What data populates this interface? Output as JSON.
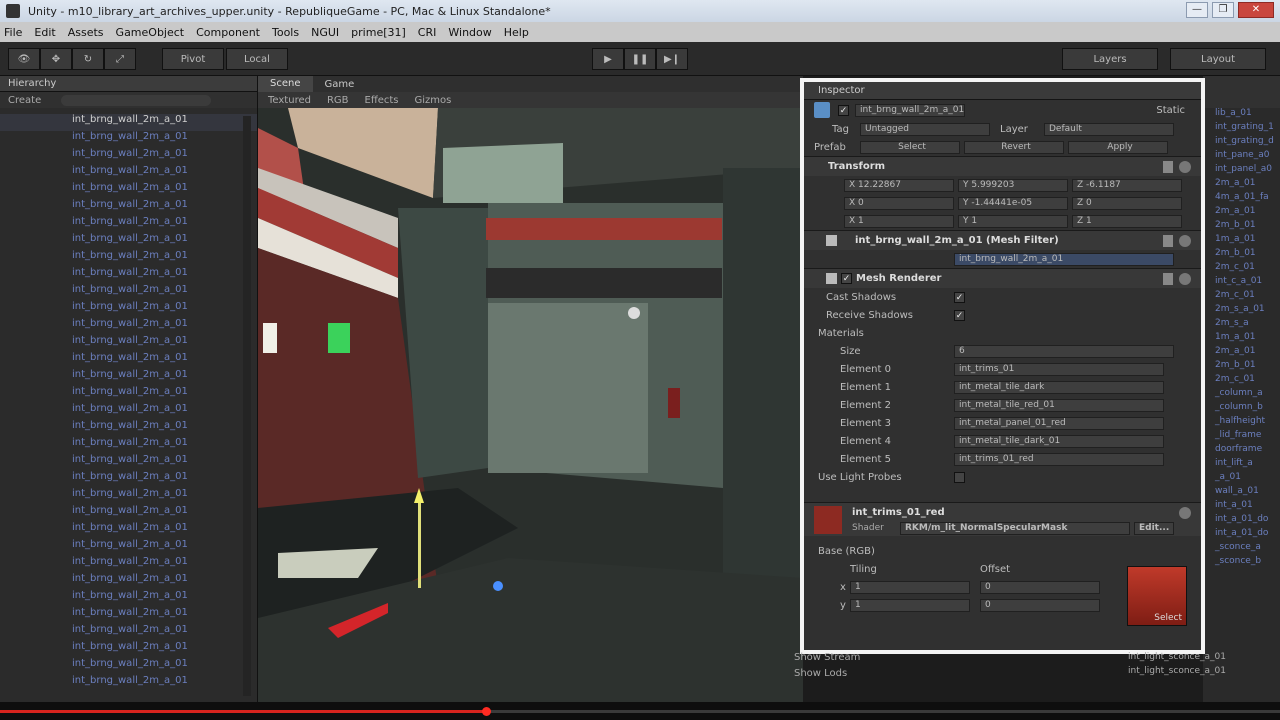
{
  "window": {
    "title": "Unity - m10_library_art_archives_upper.unity - RepubliqueGame - PC, Mac & Linux Standalone*",
    "minimize": "—",
    "maximize": "❐",
    "close": "✕"
  },
  "menu": [
    "File",
    "Edit",
    "Assets",
    "GameObject",
    "Component",
    "Tools",
    "NGUI",
    "prime[31]",
    "CRI",
    "Window",
    "Help"
  ],
  "toolbar": {
    "pivot": "Pivot",
    "local": "Local",
    "play": "▶",
    "pause": "❚❚",
    "step": "▶❙",
    "layers": "Layers",
    "layout": "Layout"
  },
  "hierarchy": {
    "tab": "Hierarchy",
    "create": "Create",
    "selected": "int_brng_wall_2m_a_01",
    "rows": [
      "int_brng_wall_2m_a_01",
      "int_brng_wall_2m_a_01",
      "int_brng_wall_2m_a_01",
      "int_brng_wall_2m_a_01",
      "int_brng_wall_2m_a_01",
      "int_brng_wall_2m_a_01",
      "int_brng_wall_2m_a_01",
      "int_brng_wall_2m_a_01",
      "int_brng_wall_2m_a_01",
      "int_brng_wall_2m_a_01",
      "int_brng_wall_2m_a_01",
      "int_brng_wall_2m_a_01",
      "int_brng_wall_2m_a_01",
      "int_brng_wall_2m_a_01",
      "int_brng_wall_2m_a_01",
      "int_brng_wall_2m_a_01",
      "int_brng_wall_2m_a_01",
      "int_brng_wall_2m_a_01",
      "int_brng_wall_2m_a_01",
      "int_brng_wall_2m_a_01",
      "int_brng_wall_2m_a_01",
      "int_brng_wall_2m_a_01",
      "int_brng_wall_2m_a_01",
      "int_brng_wall_2m_a_01",
      "int_brng_wall_2m_a_01",
      "int_brng_wall_2m_a_01",
      "int_brng_wall_2m_a_01",
      "int_brng_wall_2m_a_01",
      "int_brng_wall_2m_a_01",
      "int_brng_wall_2m_a_01",
      "int_brng_wall_2m_a_01",
      "int_brng_wall_2m_a_01",
      "int_brng_wall_2m_a_01"
    ]
  },
  "scene": {
    "tab_scene": "Scene",
    "tab_game": "Game",
    "textured": "Textured",
    "rgb": "RGB",
    "effects": "Effects",
    "gizmos": "Gizmos"
  },
  "inspector": {
    "tab": "Inspector",
    "object_name": "int_brng_wall_2m_a_01",
    "static": "Static",
    "tag_label": "Tag",
    "tag_value": "Untagged",
    "layer_label": "Layer",
    "layer_value": "Default",
    "prefab_label": "Prefab",
    "select": "Select",
    "revert": "Revert",
    "apply": "Apply",
    "transform": "Transform",
    "pos_x": "X 12.22867",
    "pos_y": "Y 5.999203",
    "pos_z": "Z -6.1187",
    "rot_x": "X 0",
    "rot_y": "Y -1.44441e-05",
    "rot_z": "Z 0",
    "scl_x": "X 1",
    "scl_y": "Y 1",
    "scl_z": "Z 1",
    "mesh_filter": "int_brng_wall_2m_a_01 (Mesh Filter)",
    "mesh_value": "int_brng_wall_2m_a_01",
    "mesh_renderer": "Mesh Renderer",
    "cast_shadows": "Cast Shadows",
    "receive_shadows": "Receive Shadows",
    "materials": "Materials",
    "size_label": "Size",
    "size_value": "6",
    "elements": [
      {
        "label": "Element 0",
        "value": "int_trims_01"
      },
      {
        "label": "Element 1",
        "value": "int_metal_tile_dark"
      },
      {
        "label": "Element 2",
        "value": "int_metal_tile_red_01"
      },
      {
        "label": "Element 3",
        "value": "int_metal_panel_01_red"
      },
      {
        "label": "Element 4",
        "value": "int_metal_tile_dark_01"
      },
      {
        "label": "Element 5",
        "value": "int_trims_01_red"
      }
    ],
    "light_probes": "Use Light Probes",
    "material_name": "int_trims_01_red",
    "shader_label": "Shader",
    "shader_value": "RKM/m_lit_NormalSpecularMask",
    "edit": "Edit...",
    "base_rgb": "Base (RGB)",
    "tiling": "Tiling",
    "offset": "Offset",
    "x": "x",
    "y": "y",
    "tile_x": "1",
    "tile_y": "1",
    "off_x": "0",
    "off_y": "0",
    "select_btn": "Select"
  },
  "right_panel": [
    "lib_a_01",
    "int_grating_1",
    "int_grating_d",
    "int_pane_a0",
    "int_panel_a0",
    "2m_a_01",
    "4m_a_01_fa",
    "2m_a_01",
    "2m_b_01",
    "1m_a_01",
    "2m_b_01",
    "2m_c_01",
    "int_c_a_01",
    "2m_c_01",
    "2m_s_a_01",
    "2m_s_a",
    "1m_a_01",
    "2m_a_01",
    "2m_b_01",
    "2m_c_01",
    "_column_a",
    "_column_b",
    "_halfheight",
    "_lid_frame",
    "doorframe",
    "int_lift_a",
    "_a_01",
    "wall_a_01",
    "int_a_01",
    "int_a_01_do",
    "int_a_01_do",
    "_sconce_a",
    "_sconce_b"
  ],
  "bottom": {
    "show_stream": "Show Stream",
    "show_lods": "Show Lods",
    "file1": "int_light_sconce_a_01",
    "file2": "int_light_sconce_a_01"
  },
  "video": {
    "progress": 0.38
  }
}
